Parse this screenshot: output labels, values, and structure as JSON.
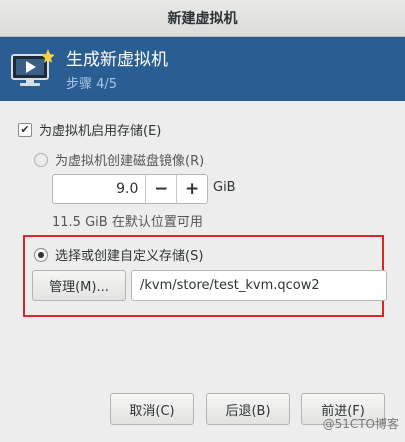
{
  "window": {
    "title": "新建虚拟机"
  },
  "header": {
    "title": "生成新虚拟机",
    "step": "步骤 4/5"
  },
  "storage": {
    "enable_label": "为虚拟机启用存储(E)",
    "enable_checked": true,
    "create_disk_label": "为虚拟机创建磁盘镜像(R)",
    "size_value": "9.0",
    "minus": "−",
    "plus": "+",
    "unit": "GiB",
    "available_note": "11.5 GiB 在默认位置可用",
    "custom_label": "选择或创建自定义存储(S)",
    "selected_option": "custom",
    "manage_label": "管理(M)...",
    "path_value": "/kvm/store/test_kvm.qcow2"
  },
  "footer": {
    "cancel_label": "取消(C)",
    "back_label": "后退(B)",
    "forward_label": "前进(F)"
  },
  "watermark": "@51CTO博客",
  "colors": {
    "banner": "#2a5e93",
    "highlight": "#d9252b"
  },
  "icons": {
    "banner": "vm-monitor-icon",
    "check": "checkmark-icon"
  }
}
